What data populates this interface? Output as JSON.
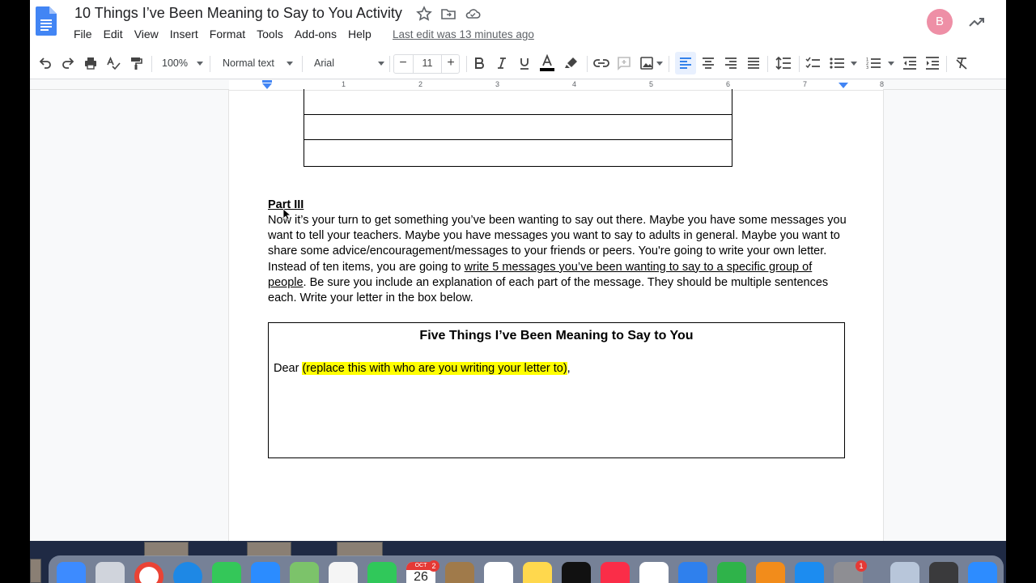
{
  "app": {
    "doc_title": "10 Things I’ve Been Meaning to Say to You Activity",
    "menu": [
      "File",
      "Edit",
      "View",
      "Insert",
      "Format",
      "Tools",
      "Add-ons",
      "Help"
    ],
    "last_edit": "Last edit was 13 minutes ago",
    "avatar_initial": "B"
  },
  "toolbar": {
    "zoom": "100%",
    "style": "Normal text",
    "font": "Arial",
    "font_size": "11",
    "minus": "−",
    "plus": "+"
  },
  "ruler": {
    "numbers": [
      "1",
      "2",
      "3",
      "4",
      "5",
      "6",
      "7",
      "8"
    ]
  },
  "document": {
    "part_heading": "Part III",
    "para_start": "Now it’s your turn to get something you’ve been wanting to say out there. Maybe you have some messages you want to tell your teachers. Maybe you have messages you want to say to adults in general. Maybe you want to share some advice/encouragement/messages to your friends or peers. You're going to write your own letter. Instead of ten items, you are going to ",
    "para_underlined": "write 5 messages you’ve been wanting to say to a specific group of people",
    "para_end": ". Be sure you include an explanation of each part of the message. They should be multiple sentences each. Write your letter in the box below.",
    "letter_title": "Five Things I’ve Been Meaning to Say to You",
    "dear": "Dear ",
    "dear_highlight": "(replace this with who are you writing your letter to)",
    "dear_end": ","
  },
  "dock": {
    "calendar_month": "OCT",
    "calendar_day": "26",
    "calendar_badge": "2",
    "settings_badge": "1"
  },
  "colors": {
    "highlight": "#ffff00",
    "avatar": "#ee8fa6",
    "docs_blue": "#4285f4"
  }
}
